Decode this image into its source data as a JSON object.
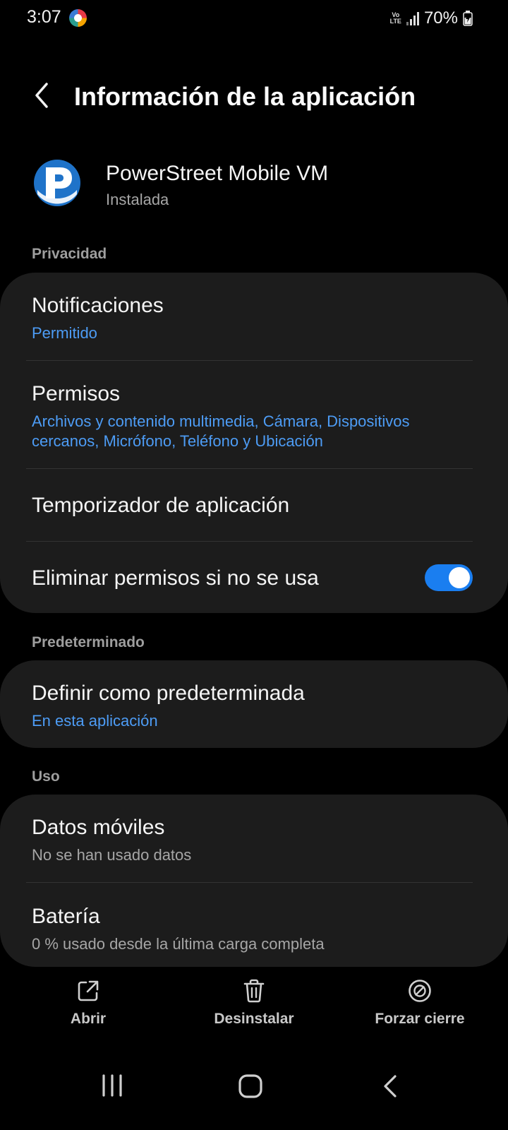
{
  "status_bar": {
    "time": "3:07",
    "network": "Vo LTE",
    "battery": "70%"
  },
  "header": {
    "title": "Información de la aplicación"
  },
  "app": {
    "name": "PowerStreet Mobile VM",
    "status": "Instalada"
  },
  "sections": {
    "privacy": {
      "label": "Privacidad",
      "notifications": {
        "title": "Notificaciones",
        "value": "Permitido"
      },
      "permissions": {
        "title": "Permisos",
        "value": "Archivos y contenido multimedia, Cámara, Dispositivos cercanos, Micrófono, Teléfono y Ubicación"
      },
      "timer": {
        "title": "Temporizador de aplicación"
      },
      "remove_permissions": {
        "title": "Eliminar permisos si no se usa",
        "enabled": true
      }
    },
    "defaults": {
      "label": "Predeterminado",
      "set_default": {
        "title": "Definir como predeterminada",
        "value": "En esta aplicación"
      }
    },
    "usage": {
      "label": "Uso",
      "mobile_data": {
        "title": "Datos móviles",
        "value": "No se han usado datos"
      },
      "battery": {
        "title": "Batería",
        "value": "0 % usado desde la última carga completa"
      }
    }
  },
  "actions": {
    "open": "Abrir",
    "uninstall": "Desinstalar",
    "force_stop": "Forzar cierre"
  },
  "colors": {
    "accent": "#4d9cf5",
    "toggle_on": "#1a7ef0",
    "card_bg": "#1c1c1c",
    "background": "#000000"
  },
  "icons": {
    "back": "chevron-left-icon",
    "open": "external-link-icon",
    "uninstall": "trash-icon",
    "force_stop": "block-icon",
    "nav_recents": "recents-icon",
    "nav_home": "home-icon",
    "nav_back": "back-nav-icon"
  }
}
